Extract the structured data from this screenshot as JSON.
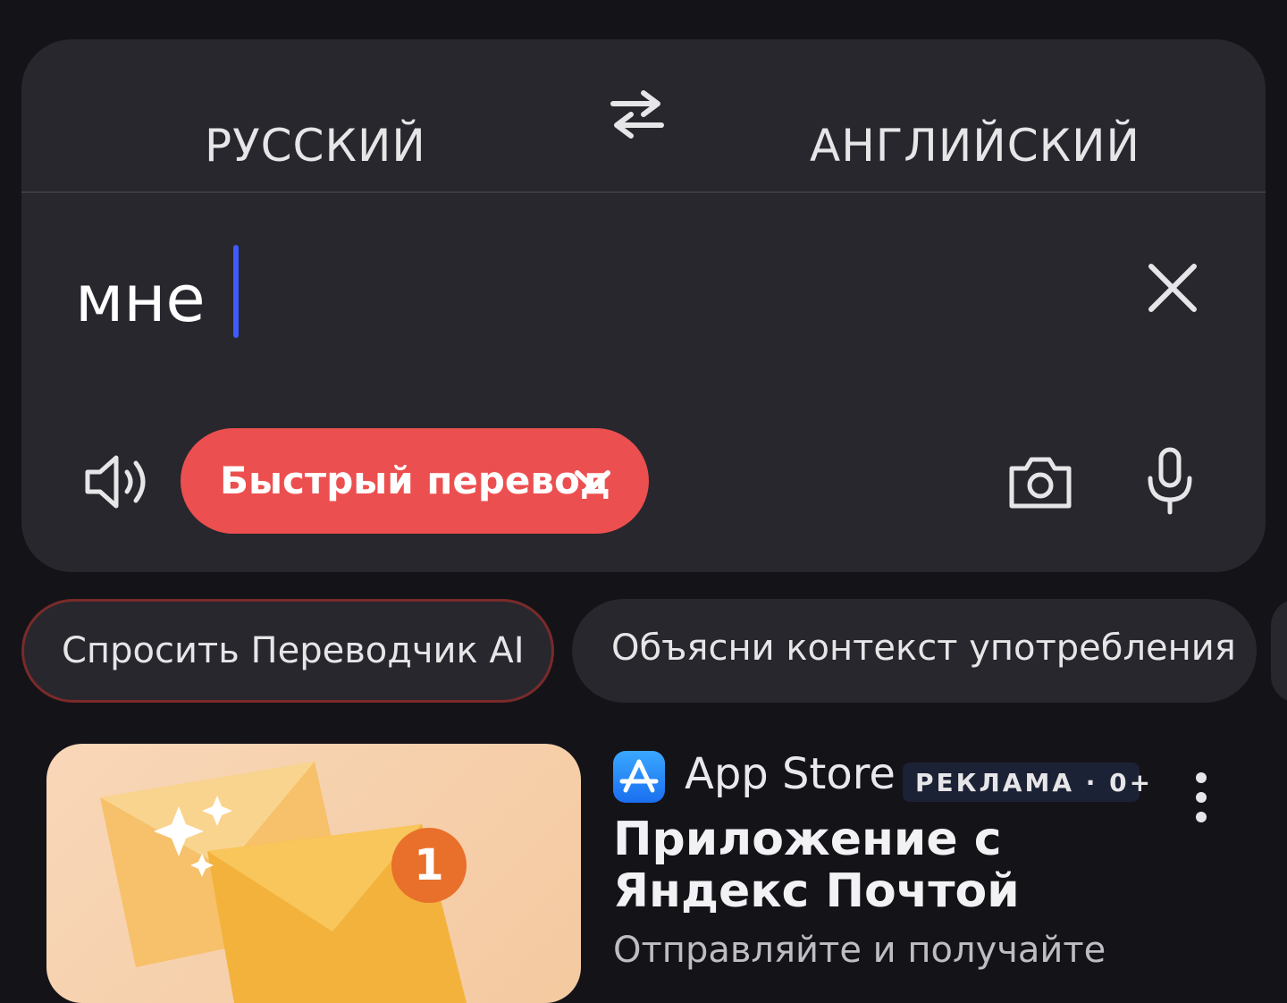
{
  "translator": {
    "source_lang": "РУССКИЙ",
    "target_lang": "АНГЛИЙСКИЙ",
    "input_value": "мне",
    "mode_label": "Быстрый перевод"
  },
  "chips": [
    {
      "label": "Спросить Переводчик AI"
    },
    {
      "label": "Объясни контекст употребления"
    }
  ],
  "ad": {
    "store": "App Store",
    "badge": "РЕКЛАМА · 0+",
    "title": "Приложение с Яндекс Почтой",
    "description": "Отправляйте и получайте",
    "image_badge_count": "1"
  },
  "colors": {
    "accent_red": "#ec4f4f",
    "caret_blue": "#3d5bff",
    "card_bg": "#28272d",
    "page_bg": "#141318"
  },
  "icons": [
    "swap-languages-icon",
    "close-icon",
    "speaker-icon",
    "chevron-down-icon",
    "camera-icon",
    "microphone-icon",
    "app-store-icon",
    "more-vertical-icon"
  ]
}
